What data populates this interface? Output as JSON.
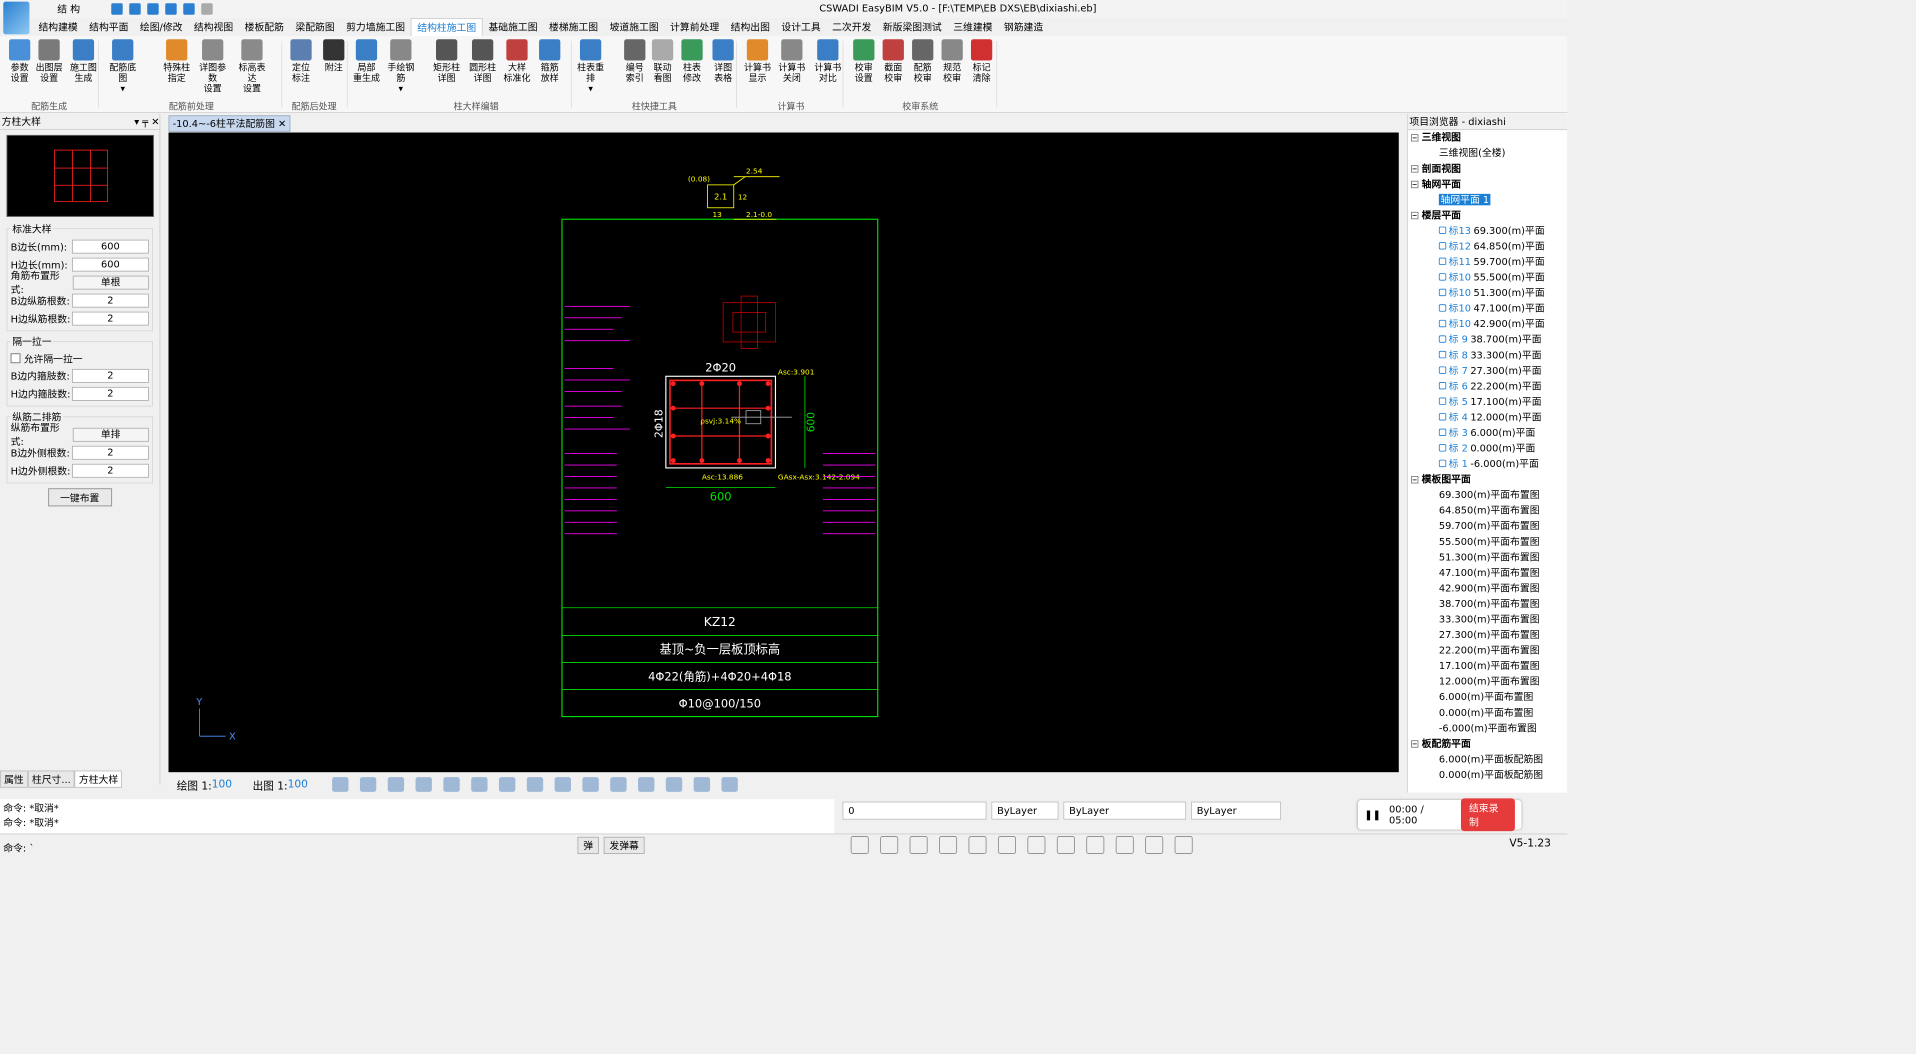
{
  "titlebar": {
    "app_title": "CSWADI EasyBIM V5.0 - [F:\\TEMP\\EB DXS\\EB\\dixiashi.eb]",
    "quick_label": "结 构",
    "window_buttons": [
      "─",
      "❐",
      "✕"
    ]
  },
  "menu": [
    "结构建模",
    "结构平面",
    "绘图/修改",
    "结构视图",
    "楼板配筋",
    "梁配筋图",
    "剪力墙施工图",
    "结构柱施工图",
    "基础施工图",
    "楼梯施工图",
    "坡道施工图",
    "计算前处理",
    "结构出图",
    "设计工具",
    "二次开发",
    "新版梁图测试",
    "三维建模",
    "钢筋建造"
  ],
  "menu_active_index": 7,
  "ribbon": {
    "buttons": [
      {
        "l1": "参数",
        "l2": "设置",
        "c": "#4a90d9"
      },
      {
        "l1": "出图层",
        "l2": "设置",
        "c": "#7a7a7a"
      },
      {
        "l1": "施工图",
        "l2": "生成",
        "c": "#3a7ec6"
      },
      {
        "l1": "配筋底图",
        "l2": "▾",
        "c": "#3a7ec6"
      },
      {
        "l1": "特殊柱",
        "l2": "指定",
        "c": "#e08a2c"
      },
      {
        "l1": "详图参数",
        "l2": "设置",
        "c": "#8a8a8a"
      },
      {
        "l1": "标高表达",
        "l2": "设置",
        "c": "#8a8a8a"
      },
      {
        "l1": "定位",
        "l2": "标注",
        "c": "#5b7fb0"
      },
      {
        "l1": "附注",
        "l2": "",
        "c": "#333333"
      },
      {
        "l1": "局部",
        "l2": "重生成",
        "c": "#3a7ec6"
      },
      {
        "l1": "手绘钢筋",
        "l2": "▾",
        "c": "#888888"
      },
      {
        "l1": "矩形柱",
        "l2": "详图",
        "c": "#555555"
      },
      {
        "l1": "圆形柱",
        "l2": "详图",
        "c": "#555555"
      },
      {
        "l1": "大样",
        "l2": "标准化",
        "c": "#c04040"
      },
      {
        "l1": "箍筋",
        "l2": "放样",
        "c": "#3a7ec6"
      },
      {
        "l1": "柱表重排",
        "l2": "▾",
        "c": "#3a7ec6"
      },
      {
        "l1": "编号",
        "l2": "索引",
        "c": "#666666"
      },
      {
        "l1": "联动",
        "l2": "看图",
        "c": "#aaaaaa"
      },
      {
        "l1": "柱表",
        "l2": "修改",
        "c": "#3a9a5a"
      },
      {
        "l1": "详图",
        "l2": "表格",
        "c": "#3a7ec6"
      },
      {
        "l1": "计算书",
        "l2": "显示",
        "c": "#e08a2c"
      },
      {
        "l1": "计算书",
        "l2": "关闭",
        "c": "#888888"
      },
      {
        "l1": "计算书",
        "l2": "对比",
        "c": "#3a7ec6"
      },
      {
        "l1": "校审",
        "l2": "设置",
        "c": "#3a9a5a"
      },
      {
        "l1": "截面",
        "l2": "校审",
        "c": "#c04040"
      },
      {
        "l1": "配筋",
        "l2": "校审",
        "c": "#666666"
      },
      {
        "l1": "规范",
        "l2": "校审",
        "c": "#888888"
      },
      {
        "l1": "标记",
        "l2": "清除",
        "c": "#d03030"
      }
    ],
    "groups": [
      "配筋生成",
      "配筋前处理",
      "配筋后处理",
      "柱大样编辑",
      "柱快捷工具",
      "计算书",
      "校审系统"
    ]
  },
  "left_panel": {
    "title": "方柱大样",
    "standard_title": "标准大样",
    "fields": [
      {
        "label": "B边长(mm):",
        "value": "600"
      },
      {
        "label": "H边长(mm):",
        "value": "600"
      },
      {
        "label": "角筋布置形式:",
        "value": "单根",
        "select": true
      },
      {
        "label": "B边纵筋根数:",
        "value": "2"
      },
      {
        "label": "H边纵筋根数:",
        "value": "2"
      }
    ],
    "tie_title": "隔一拉一",
    "tie_check": "允许隔一拉一",
    "tie_fields": [
      {
        "label": "B边内箍肢数:",
        "value": "2"
      },
      {
        "label": "H边内箍肢数:",
        "value": "2"
      }
    ],
    "row2_title": "纵筋二排筋",
    "row2_fields": [
      {
        "label": "纵筋布置形式:",
        "value": "单排",
        "select": true
      },
      {
        "label": "B边外侧根数:",
        "value": "2"
      },
      {
        "label": "H边外侧根数:",
        "value": "2"
      }
    ],
    "one_key": "一键布置",
    "tabs": [
      "属性",
      "柱尺寸...",
      "方柱大样"
    ]
  },
  "doc_tab": "-10.4~-6柱平法配筋图",
  "drawing": {
    "top_detail": {
      "left": "(0.08)",
      "value": "2.1",
      "right_top": "2.54",
      "right_bottom": "2.1-0.0",
      "bottom": "13",
      "side": "12"
    },
    "top_bars": "2Φ20",
    "side_bars": "2Φ18",
    "asc_top": "Asc:3.901",
    "asc_bottom": "Asc:13.886",
    "asx": "GAsx-Asx:3.142-2.094",
    "center_text": "ρsvj:3.14%",
    "dim_b": "600",
    "dim_h": "600",
    "kz": "KZ12",
    "elev": "基顶~负一层板顶标高",
    "main_bars": "4Φ22(角筋)+4Φ20+4Φ18",
    "stirrup": "Φ10@100/150",
    "axis_x": "X",
    "axis_y": "Y"
  },
  "status": {
    "draw_scale_label": "绘图 1:",
    "draw_scale": "100",
    "out_scale_label": "出图 1:",
    "out_scale": "100"
  },
  "right_panel": {
    "title": "项目浏览器 - dixiashi",
    "groups": [
      {
        "name": "三维视图",
        "items": [
          "三维视图(全楼)"
        ]
      },
      {
        "name": "剖面视图",
        "items": []
      },
      {
        "name": "轴网平面",
        "items": [
          "轴网平面 1"
        ],
        "selected": 0
      },
      {
        "name": "楼层平面",
        "floors": [
          {
            "tag": "标13",
            "txt": "69.300(m)平面"
          },
          {
            "tag": "标12",
            "txt": "64.850(m)平面"
          },
          {
            "tag": "标11",
            "txt": "59.700(m)平面"
          },
          {
            "tag": "标10",
            "txt": "55.500(m)平面"
          },
          {
            "tag": "标10",
            "txt": "51.300(m)平面"
          },
          {
            "tag": "标10",
            "txt": "47.100(m)平面"
          },
          {
            "tag": "标10",
            "txt": "42.900(m)平面"
          },
          {
            "tag": "标 9",
            "txt": "38.700(m)平面"
          },
          {
            "tag": "标 8",
            "txt": "33.300(m)平面"
          },
          {
            "tag": "标 7",
            "txt": "27.300(m)平面"
          },
          {
            "tag": "标 6",
            "txt": "22.200(m)平面"
          },
          {
            "tag": "标 5",
            "txt": "17.100(m)平面"
          },
          {
            "tag": "标 4",
            "txt": "12.000(m)平面"
          },
          {
            "tag": "标 3",
            "txt": "6.000(m)平面"
          },
          {
            "tag": "标 2",
            "txt": "0.000(m)平面"
          },
          {
            "tag": "标 1",
            "txt": "-6.000(m)平面"
          }
        ]
      },
      {
        "name": "模板图平面",
        "items": [
          "69.300(m)平面布置图",
          "64.850(m)平面布置图",
          "59.700(m)平面布置图",
          "55.500(m)平面布置图",
          "51.300(m)平面布置图",
          "47.100(m)平面布置图",
          "42.900(m)平面布置图",
          "38.700(m)平面布置图",
          "33.300(m)平面布置图",
          "27.300(m)平面布置图",
          "22.200(m)平面布置图",
          "17.100(m)平面布置图",
          "12.000(m)平面布置图",
          "6.000(m)平面布置图",
          "0.000(m)平面布置图",
          "-6.000(m)平面布置图"
        ]
      },
      {
        "name": "板配筋平面",
        "items": [
          "6.000(m)平面板配筋图",
          "0.000(m)平面板配筋图"
        ]
      }
    ]
  },
  "command": {
    "lines": [
      "命令: *取消*",
      "命令: *取消*"
    ],
    "prompt": "命令: `"
  },
  "layer": {
    "layer_value": "0",
    "color": "ByLayer",
    "linetype": "ByLayer",
    "lineweight": "ByLayer"
  },
  "toggles": [
    "弹",
    "发弹幕"
  ],
  "recorder": {
    "time": "00:00 / 05:00",
    "stop": "结束录制"
  },
  "version": "V5-1.23"
}
